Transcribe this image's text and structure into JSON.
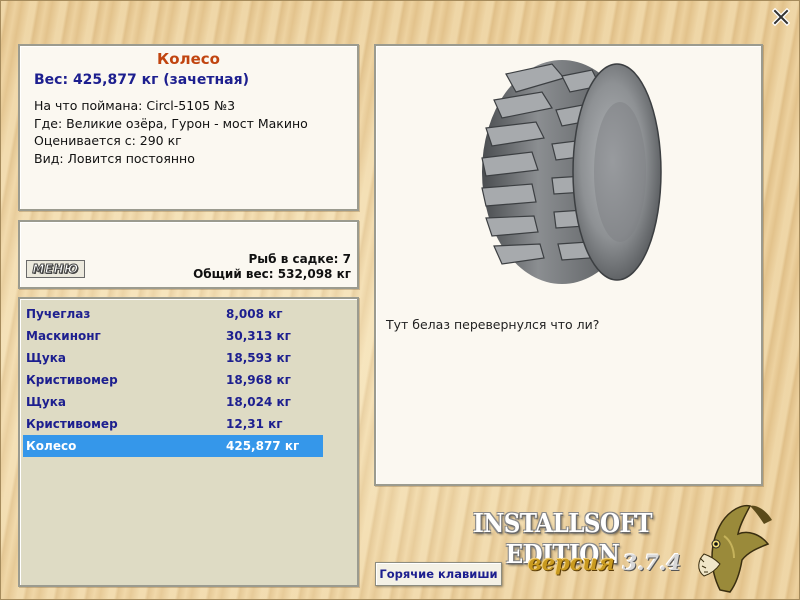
{
  "info": {
    "title": "Колесо",
    "weight": "Вес: 425,877 кг (зачетная)",
    "caught_on": "На что поймана: Circl-5105 №3",
    "location": "Где: Великие озёра, Гурон - мост Макино",
    "rated_from": "Оценивается с: 290 кг",
    "kind": "Вид: Ловится постоянно"
  },
  "summary": {
    "menu_label": "МЕНЮ",
    "fish_count": "Рыб в садке: 7",
    "total_weight": "Общий вес: 532,098 кг"
  },
  "catch_list": [
    {
      "name": "Пучеглаз",
      "weight": "8,008 кг"
    },
    {
      "name": "Маскинонг",
      "weight": "30,313 кг"
    },
    {
      "name": "Щука",
      "weight": "18,593 кг"
    },
    {
      "name": "Кристивомер",
      "weight": "18,968 кг"
    },
    {
      "name": "Щука",
      "weight": "18,024 кг"
    },
    {
      "name": "Кристивомер",
      "weight": "12,31 кг"
    },
    {
      "name": "Колесо",
      "weight": "425,877 кг",
      "selected": true
    }
  ],
  "detail": {
    "image": "tire-image",
    "comment": "Тут белаз перевернулся что ли?"
  },
  "brand": {
    "edition": "INSTALLSOFT EDITION",
    "version_label": "версия",
    "version_number": "3.7.4"
  },
  "hotkeys_label": "Горячие клавиши",
  "icons": {
    "close": "close-icon",
    "logo": "pike-fish-icon"
  },
  "colors": {
    "title": "#c1440f",
    "accent_text": "#1d1f8f",
    "selection": "#3597ea",
    "list_bg": "#dedbc4"
  }
}
